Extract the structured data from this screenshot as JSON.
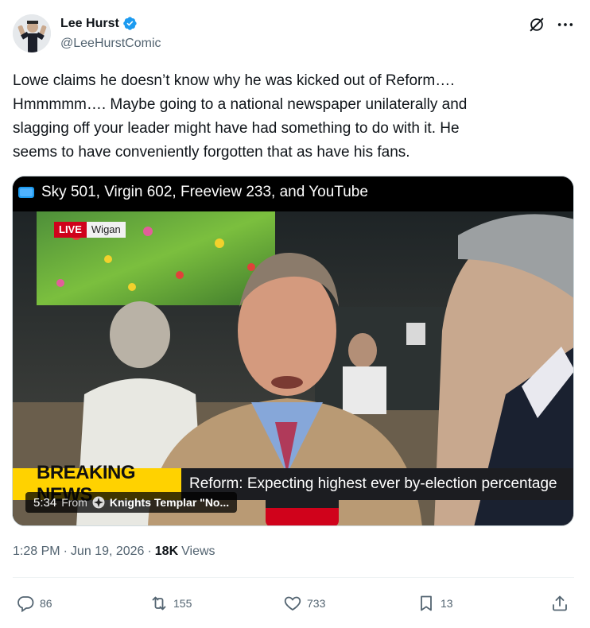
{
  "author": {
    "display_name": "Lee Hurst",
    "handle": "@LeeHurstComic",
    "verified": true
  },
  "header_icons": {
    "grok": "grok-icon",
    "more": "more-icon"
  },
  "tweet": {
    "text": "Lowe claims he doesn’t know why he was kicked out of Reform….\nHmmmmm…. Maybe going to a national newspaper unilaterally and\nslagging off your leader might have had something to do with it. He\nseems to have conveniently forgotten that as have his fans."
  },
  "media": {
    "channel_text": "Sky 501, Virgin 602, Freeview 233, and YouTube",
    "live_label": "LIVE",
    "location_label": "Wigan",
    "breaking_label": "BREAKING NEWS",
    "breaking_headline": "Reform: Expecting highest ever by-election percentage",
    "duration": "5:34",
    "from_label": "From",
    "source_name": "Knights Templar \"No..."
  },
  "meta": {
    "time": "1:28 PM",
    "separator": "·",
    "date": "Jun 19, 2026",
    "views_count": "18K",
    "views_label": "Views"
  },
  "actions": {
    "replies": "86",
    "reposts": "155",
    "likes": "733",
    "bookmarks": "13"
  },
  "colors": {
    "text": "#0f1419",
    "secondary": "#536471",
    "verified": "#1d9bf0",
    "live_red": "#d0021b",
    "breaking_yellow": "#ffd200"
  }
}
